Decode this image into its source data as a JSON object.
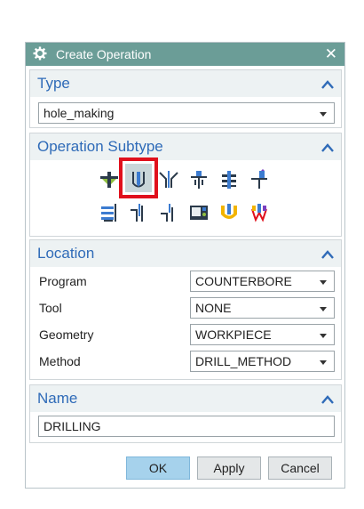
{
  "dialog": {
    "title": "Create Operation",
    "close": "✕"
  },
  "type_group": {
    "title": "Type",
    "selected": "hole_making"
  },
  "subtype_group": {
    "title": "Operation Subtype",
    "icons": [
      "spot-drill-icon",
      "drilling-icon",
      "hole-chamfer-icon",
      "counter-bore-icon",
      "thread-mill-icon",
      "hole-milling-icon",
      "tap-icon",
      "ream-icon",
      "back-counter-sink-icon",
      "cylinder-display-icon",
      "boss-milling-icon",
      "sequential-drill-icon"
    ],
    "selected_icon": "drilling-icon"
  },
  "location_group": {
    "title": "Location",
    "rows": [
      {
        "label": "Program",
        "value": "COUNTERBORE"
      },
      {
        "label": "Tool",
        "value": "NONE"
      },
      {
        "label": "Geometry",
        "value": "WORKPIECE"
      },
      {
        "label": "Method",
        "value": "DRILL_METHOD"
      }
    ]
  },
  "name_group": {
    "title": "Name",
    "value": "DRILLING"
  },
  "buttons": {
    "ok": "OK",
    "apply": "Apply",
    "cancel": "Cancel"
  },
  "colors": {
    "title_bar": "#6b9d97",
    "heading_blue": "#2f6bb8",
    "highlight_red": "#e0101c",
    "ok_button": "#a6d2ec"
  }
}
